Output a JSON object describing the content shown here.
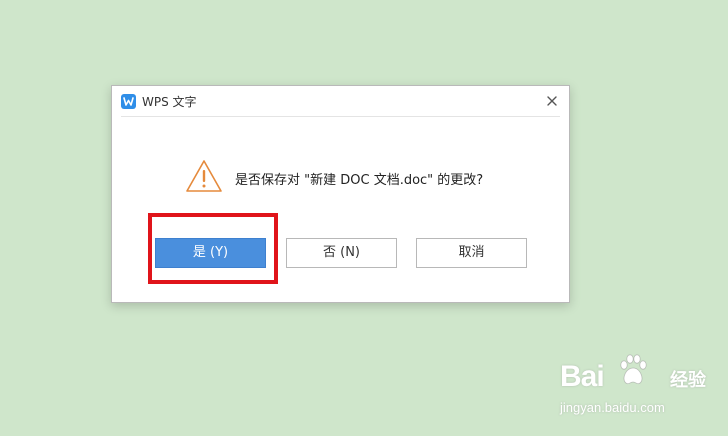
{
  "dialog": {
    "title": "WPS 文字",
    "app_icon": "wps-writer-icon",
    "close_icon": "close-icon",
    "message": "是否保存对 \"新建 DOC 文档.doc\" 的更改?",
    "warning_icon": "warning-triangle-icon",
    "buttons": {
      "yes": "是 (Y)",
      "no": "否 (N)",
      "cancel": "取消"
    }
  },
  "annotation": {
    "highlight_color": "#e0141a",
    "highlight_target": "yes-button"
  },
  "watermark": {
    "logo": "Bai",
    "logo_suffix": "经验",
    "url": "jingyan.baidu.com"
  },
  "colors": {
    "background": "#cfe6cb",
    "primary_button": "#4a8fdd",
    "warning": "#e58a3c",
    "app_icon": "#2f8ee8"
  }
}
